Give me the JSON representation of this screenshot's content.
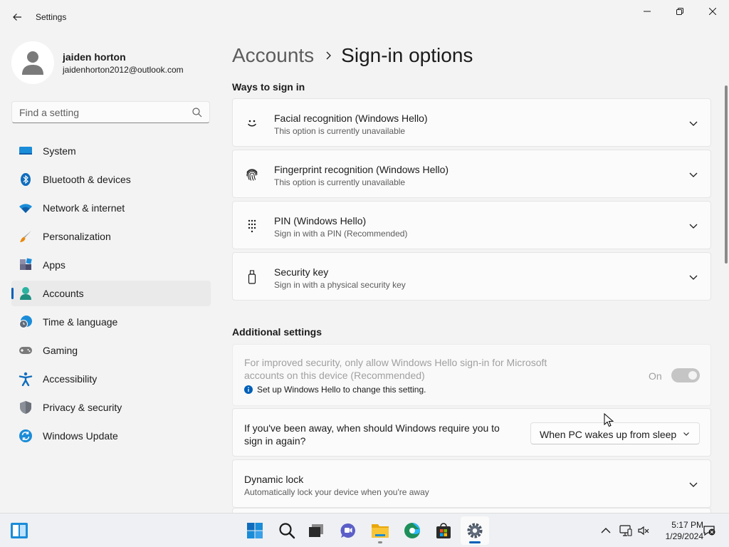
{
  "window": {
    "title": "Settings",
    "icons": {
      "back": "back-arrow-icon",
      "minimize": "minimize-icon",
      "maximize": "maximize-icon",
      "close": "close-icon"
    }
  },
  "profile": {
    "name": "jaiden horton",
    "email": "jaidenhorton2012@outlook.com"
  },
  "search": {
    "placeholder": "Find a setting"
  },
  "nav": {
    "selected": "Accounts",
    "items": [
      {
        "label": "System",
        "icon": "system-icon"
      },
      {
        "label": "Bluetooth & devices",
        "icon": "bluetooth-icon"
      },
      {
        "label": "Network & internet",
        "icon": "wifi-icon"
      },
      {
        "label": "Personalization",
        "icon": "brush-icon"
      },
      {
        "label": "Apps",
        "icon": "apps-icon"
      },
      {
        "label": "Accounts",
        "icon": "accounts-icon"
      },
      {
        "label": "Time & language",
        "icon": "clock-globe-icon"
      },
      {
        "label": "Gaming",
        "icon": "gamepad-icon"
      },
      {
        "label": "Accessibility",
        "icon": "accessibility-icon"
      },
      {
        "label": "Privacy & security",
        "icon": "shield-icon"
      },
      {
        "label": "Windows Update",
        "icon": "update-icon"
      }
    ]
  },
  "breadcrumb": {
    "parent": "Accounts",
    "current": "Sign-in options"
  },
  "ways": {
    "title": "Ways to sign in",
    "items": [
      {
        "title": "Facial recognition (Windows Hello)",
        "subtitle": "This option is currently unavailable",
        "icon": "face-icon"
      },
      {
        "title": "Fingerprint recognition (Windows Hello)",
        "subtitle": "This option is currently unavailable",
        "icon": "fingerprint-icon"
      },
      {
        "title": "PIN (Windows Hello)",
        "subtitle": "Sign in with a PIN (Recommended)",
        "icon": "pin-keypad-icon"
      },
      {
        "title": "Security key",
        "subtitle": "Sign in with a physical security key",
        "icon": "usb-key-icon"
      }
    ]
  },
  "additional": {
    "title": "Additional settings",
    "hello_only": {
      "text": "For improved security, only allow Windows Hello sign-in for Microsoft accounts on this device (Recommended)",
      "info": "Set up Windows Hello to change this setting.",
      "toggle_label": "On",
      "enabled": false
    },
    "away": {
      "text": "If you've been away, when should Windows require you to sign in again?",
      "value": "When PC wakes up from sleep"
    },
    "dynamic_lock": {
      "title": "Dynamic lock",
      "subtitle": "Automatically lock your device when you're away",
      "icon": "dynamic-lock-icon"
    }
  },
  "taskbar": {
    "apps": [
      "start-icon",
      "search-icon",
      "task-view-icon",
      "chat-icon",
      "file-explorer-icon",
      "edge-icon",
      "store-icon",
      "settings-gear-icon"
    ],
    "tray": [
      "chevron-up-icon",
      "network-icon",
      "volume-muted-icon",
      "notification-icon"
    ],
    "time": "5:17 PM",
    "date": "1/29/2024"
  },
  "colors": {
    "accent": "#005fb8",
    "background": "#f3f3f3",
    "card": "#fbfbfb"
  }
}
